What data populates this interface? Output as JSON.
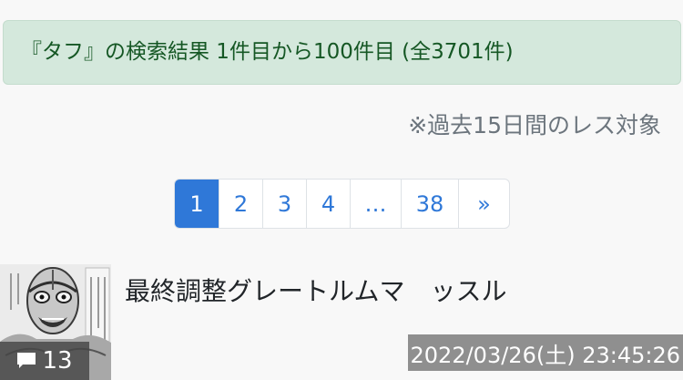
{
  "banner": {
    "text": "『タフ』の検索結果 1件目から100件目 (全3701件)"
  },
  "scope_note": "※過去15日間のレス対象",
  "pagination": {
    "pages": [
      "1",
      "2",
      "3",
      "4",
      "…",
      "38"
    ],
    "next_label": "»",
    "active": "1"
  },
  "thread": {
    "title": "最終調整グレートルムマ　ッスル",
    "reply_count": "13",
    "timestamp": "2022/03/26(土) 23:45:26",
    "thumbnail_icon": "masked-wrestler-manga-image"
  },
  "colors": {
    "accent": "#2f78d8",
    "banner_bg": "#d4e8dc",
    "banner_text": "#155724"
  }
}
